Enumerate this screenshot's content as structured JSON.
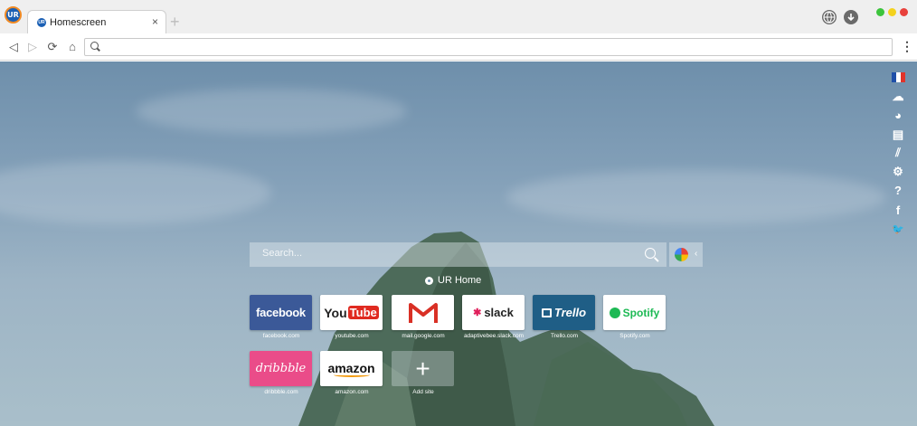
{
  "browser": {
    "logo": "UR",
    "tab": {
      "title": "Homescreen",
      "favicon": "UR",
      "close": "×"
    },
    "new_tab": "+"
  },
  "toolbar": {
    "back_icon": "◁",
    "forward_icon": "▷",
    "reload_icon": "⟳",
    "home_icon": "⌂",
    "address_value": "",
    "menu_icon": "⋮"
  },
  "sidebar_icons": [
    "flag-france-icon",
    "weather-icon",
    "palette-icon",
    "news-icon",
    "stats-icon",
    "gear-icon",
    "help-icon",
    "facebook-icon",
    "twitter-icon"
  ],
  "sidebar_glyphs": {
    "weather": "☁",
    "palette": "◕",
    "news": "▤",
    "stats": "⫽",
    "settings": "⚙",
    "help": "?",
    "facebook": "f",
    "twitter": "🐦"
  },
  "search": {
    "placeholder": "Search...",
    "engine_arrow": "‹"
  },
  "urhome": {
    "label": "UR Home"
  },
  "tiles": [
    {
      "name": "facebook",
      "brand": "facebook",
      "label": "facebook.com",
      "color": "#3b5998"
    },
    {
      "name": "youtube",
      "brand_a": "You",
      "brand_b": "Tube",
      "label": "youtube.com",
      "color": "#e02a20"
    },
    {
      "name": "gmail",
      "brand": "M",
      "label": "mail.google.com",
      "color": "#d93025"
    },
    {
      "name": "slack",
      "brand": "slack",
      "label": "adaptivebee.slack.com",
      "color": "#e01e5a"
    },
    {
      "name": "trello",
      "brand": "Trello",
      "label": "Trello.com",
      "color": "#1f5e86"
    },
    {
      "name": "spotify",
      "brand": "Spotify",
      "label": "Spotify.com",
      "color": "#1db954"
    },
    {
      "name": "dribbble",
      "brand": "dribbble",
      "label": "dribbble.com",
      "color": "#ea4c89"
    },
    {
      "name": "amazon",
      "brand": "amazon",
      "label": "amazon.com",
      "color": "#f39c12"
    },
    {
      "name": "add-site",
      "brand": "+",
      "label": "Add site"
    }
  ]
}
